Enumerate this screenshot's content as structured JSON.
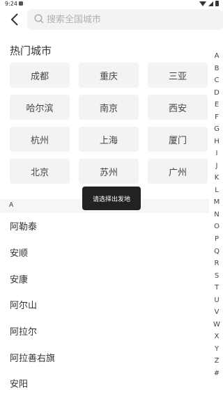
{
  "status_bar": {
    "time": "9:24"
  },
  "header": {
    "search_placeholder": "搜索全国城市"
  },
  "hot": {
    "title": "热门城市",
    "cities": [
      "成都",
      "重庆",
      "三亚",
      "哈尔滨",
      "南京",
      "西安",
      "杭州",
      "上海",
      "厦门",
      "北京",
      "苏州",
      "广州"
    ]
  },
  "section": {
    "letter": "A"
  },
  "cities_a": [
    "阿勒泰",
    "安顺",
    "安康",
    "阿尔山",
    "阿拉尔",
    "阿拉善右旗",
    "安阳"
  ],
  "index_letters": [
    "A",
    "B",
    "C",
    "D",
    "E",
    "F",
    "G",
    "H",
    "I",
    "J",
    "K",
    "L",
    "M",
    "N",
    "O",
    "P",
    "Q",
    "R",
    "S",
    "T",
    "U",
    "V",
    "W",
    "X",
    "Y",
    "Z",
    "#"
  ],
  "toast": {
    "text": "请选择出发地"
  },
  "colors": {
    "background": "#ffffff",
    "cell": "#f3f3f3",
    "toast": "#222222"
  }
}
